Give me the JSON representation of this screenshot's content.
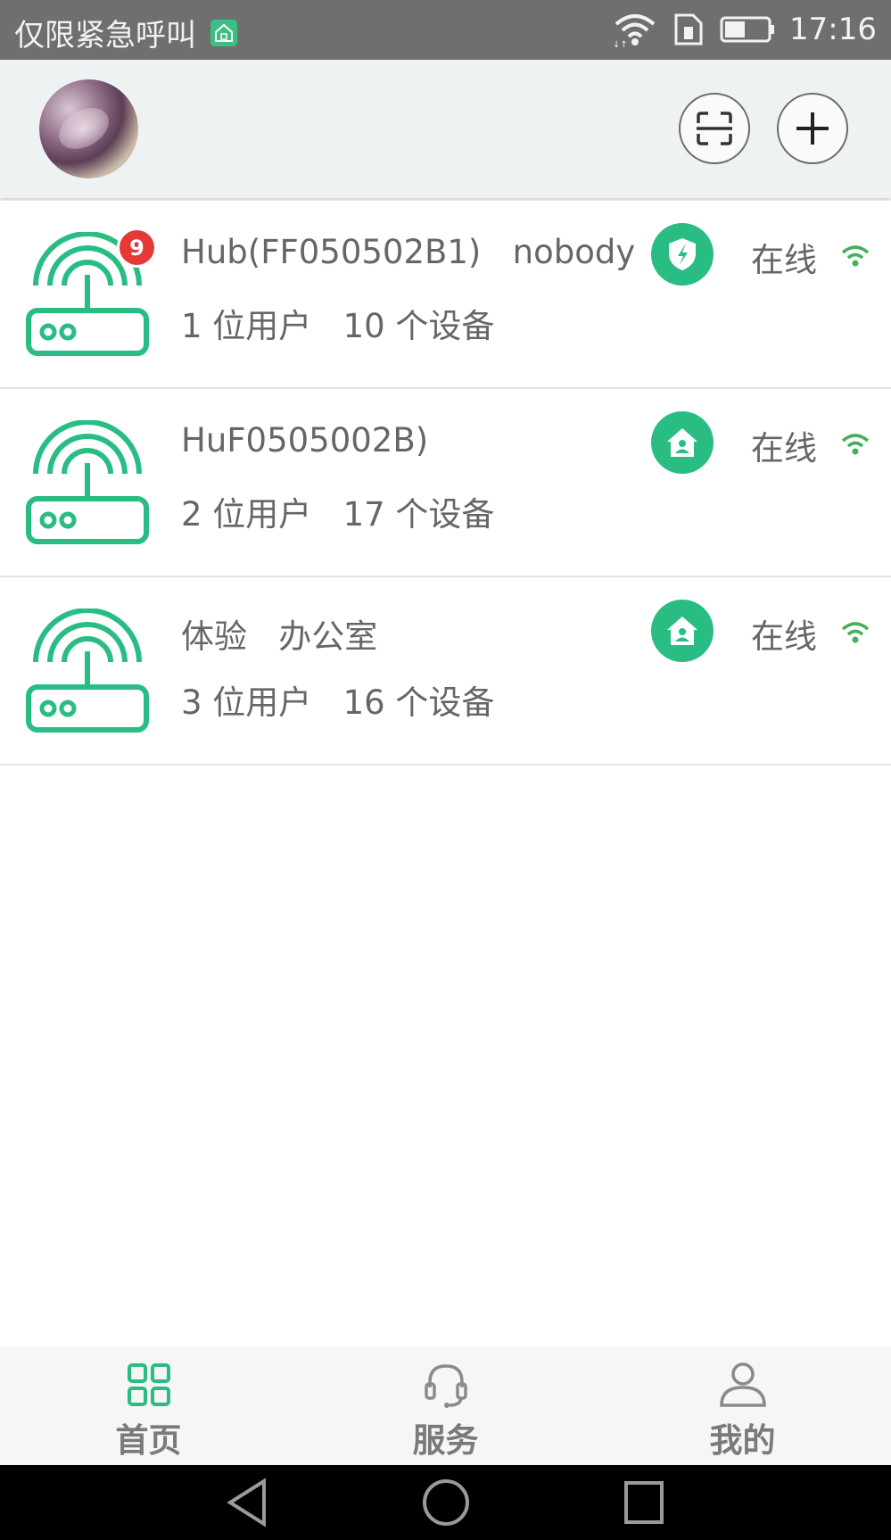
{
  "status_bar": {
    "carrier": "仅限紧急呼叫",
    "time": "17:16",
    "icons": [
      "app-home-icon",
      "wifi-icon",
      "sim-icon",
      "battery-icon"
    ]
  },
  "header": {
    "avatar": "avatar",
    "buttons": [
      "scan-icon",
      "plus-icon"
    ]
  },
  "hubs": [
    {
      "name": "Hub(FF050502B1)   nobody",
      "meta": "1 位用户   10 个设备",
      "badge": "9",
      "mode_icon": "shield-icon",
      "status": "在线"
    },
    {
      "name": "HuF0505002B)",
      "meta": "2 位用户   17 个设备",
      "badge": "",
      "mode_icon": "home-icon",
      "status": "在线"
    },
    {
      "name": "体验   办公室",
      "meta": "3 位用户   16 个设备",
      "badge": "",
      "mode_icon": "home-icon",
      "status": "在线"
    }
  ],
  "bottom_nav": [
    {
      "label": "首页",
      "icon": "grid-icon",
      "active": true
    },
    {
      "label": "服务",
      "icon": "headset-icon",
      "active": false
    },
    {
      "label": "我的",
      "icon": "user-icon",
      "active": false
    }
  ],
  "colors": {
    "accent": "#29bd84",
    "badge": "#e53935",
    "signal": "#43b05c",
    "status_bar": "#6f6f6f",
    "header_bg": "#eef2f3"
  }
}
